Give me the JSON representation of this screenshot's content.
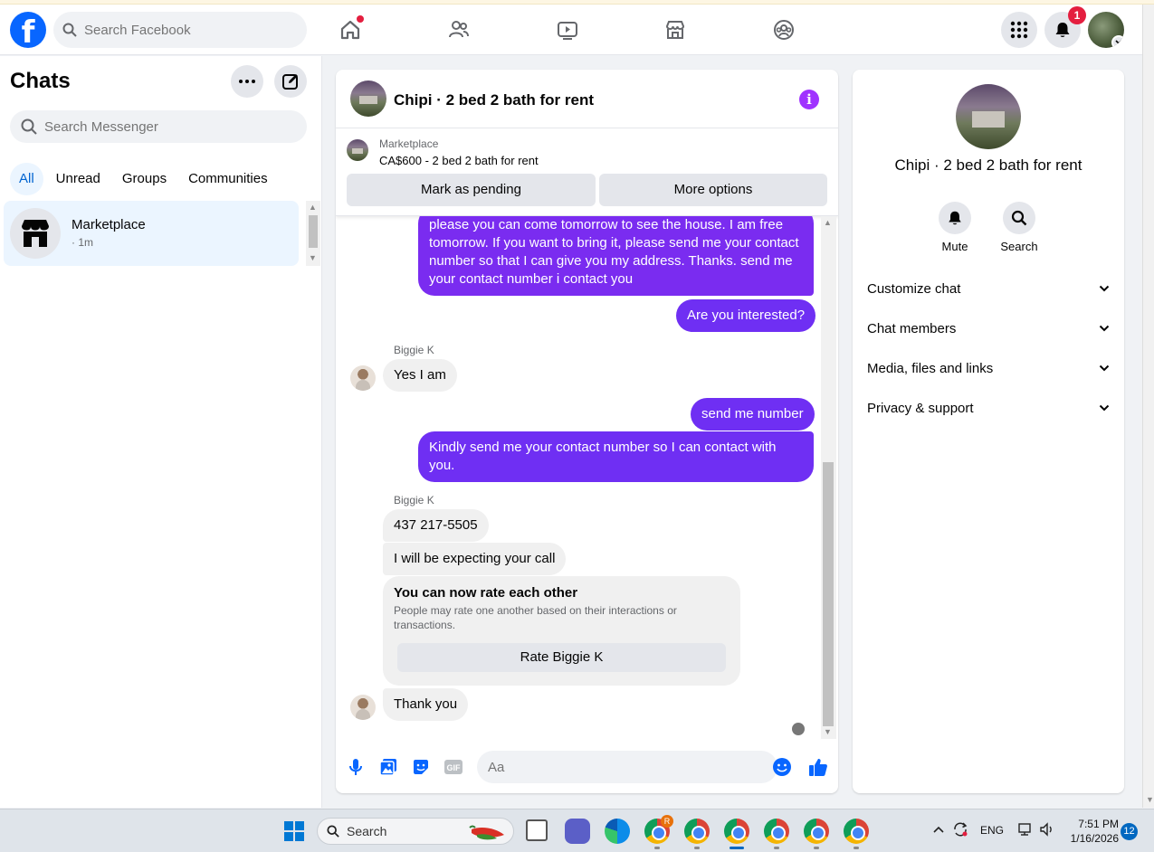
{
  "header": {
    "logo_letter": "f",
    "search_placeholder": "Search Facebook",
    "notifications_badge": "1",
    "colors": {
      "brand": "#0866ff",
      "badge": "#e41e3f"
    }
  },
  "sidebar": {
    "title": "Chats",
    "search_placeholder": "Search Messenger",
    "filters": [
      {
        "label": "All",
        "active": true
      },
      {
        "label": "Unread",
        "active": false
      },
      {
        "label": "Groups",
        "active": false
      },
      {
        "label": "Communities",
        "active": false
      }
    ],
    "conversations": [
      {
        "name": "Marketplace",
        "time": "· 1m"
      }
    ]
  },
  "chat": {
    "title": "Chipi · 2 bed 2 bath for rent",
    "marketplace_label": "Marketplace",
    "listing": "CA$600 - 2 bed 2 bath for rent",
    "actions": {
      "pending": "Mark as pending",
      "more": "More options"
    },
    "messages": [
      {
        "from": "me",
        "text": "please you can come tomorrow to see the house. I am free tomorrow. If you want to bring it, please send me your contact number so that I can give you my address. Thanks. send me your contact number   i contact you"
      },
      {
        "from": "me",
        "text": "Are you interested?"
      },
      {
        "from": "them",
        "sender": "Biggie K",
        "text": "Yes I am"
      },
      {
        "from": "me",
        "text": "send me number"
      },
      {
        "from": "me",
        "text": "Kindly send me your contact number so I can contact with you."
      },
      {
        "from": "them",
        "sender": "Biggie K",
        "text": "437 217-5505"
      },
      {
        "from": "them",
        "text": "I will be expecting your call"
      },
      {
        "from": "them",
        "text": "Thank you"
      }
    ],
    "rating": {
      "title": "You can now rate each other",
      "description": "People may rate one another based on their interactions or transactions.",
      "button": "Rate Biggie K"
    },
    "composer_placeholder": "Aa",
    "colors": {
      "outgoing": "#7a2cf0",
      "accent": "#0866ff"
    }
  },
  "info": {
    "name": "Chipi · 2 bed 2 bath for rent",
    "actions": {
      "mute": "Mute",
      "search": "Search"
    },
    "sections": [
      "Customize chat",
      "Chat members",
      "Media, files and links",
      "Privacy & support"
    ]
  },
  "taskbar": {
    "search_label": "Search",
    "language": "ENG",
    "time": "7:51 PM",
    "date": "1/16/2026",
    "notifications": "12",
    "chrome_badge": "R"
  }
}
